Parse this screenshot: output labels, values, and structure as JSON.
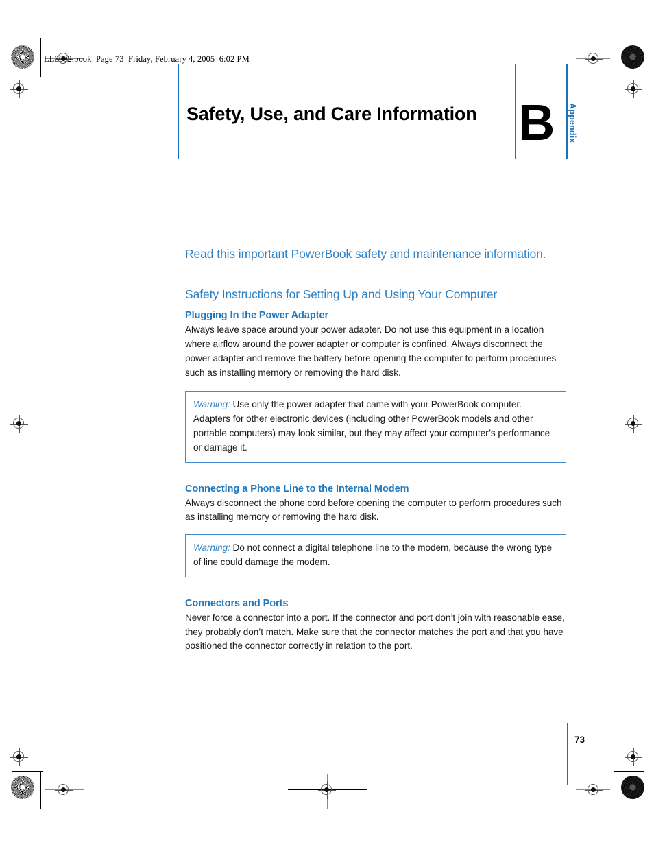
{
  "document": {
    "running_header": "LL3092.book  Page 73  Friday, February 4, 2005  6:02 PM",
    "chapter_title": "Safety, Use, and Care Information",
    "appendix_letter": "B",
    "appendix_label": "Appendix",
    "page_number": "73"
  },
  "colors": {
    "accent_blue": "#2c81c6",
    "rule_blue": "#1b72b8",
    "subhead_blue": "#2079bf",
    "box_border_blue": "#3b8bcd",
    "body_text": "#1a1a1a"
  },
  "content": {
    "intro": "Read this important PowerBook safety and maintenance information.",
    "section_heading": "Safety Instructions for Setting Up and Using Your Computer",
    "subsections": [
      {
        "heading": "Plugging In the Power Adapter",
        "body": "Always leave space around your power adapter. Do not use this equipment in a location where airflow around the power adapter or computer is confined. Always disconnect the power adapter and remove the battery before opening the computer to perform procedures such as installing memory or removing the hard disk."
      },
      {
        "heading": "Connecting a Phone Line to the Internal Modem",
        "body": "Always disconnect the phone cord before opening the computer to perform procedures such as installing memory or removing the hard disk."
      },
      {
        "heading": "Connectors and Ports",
        "body": "Never force a connector into a port. If the connector and port don’t join with reasonable ease, they probably don’t match. Make sure that the connector matches the port and that you have positioned the connector correctly in relation to the port."
      }
    ],
    "warnings": [
      {
        "label": "Warning:",
        "text": " Use only the power adapter that came with your PowerBook computer. Adapters for other electronic devices (including other PowerBook models and other portable computers) may look similar, but they may affect your computer’s performance or damage it."
      },
      {
        "label": "Warning:",
        "text": " Do not connect a digital telephone line to the modem, because the wrong type of line could damage the modem."
      }
    ]
  }
}
